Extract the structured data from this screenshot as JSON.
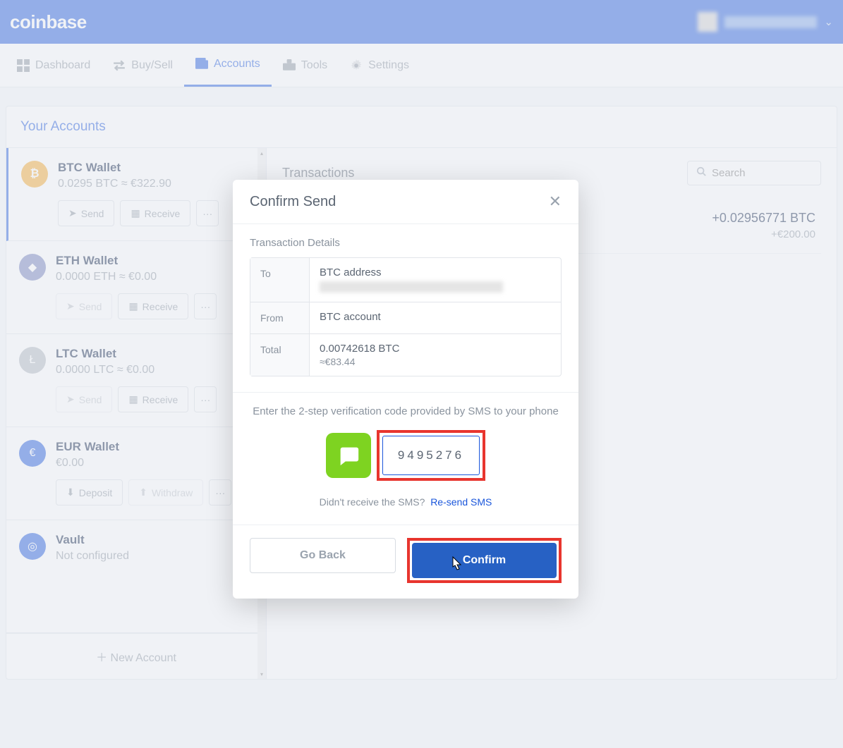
{
  "brand": "coinbase",
  "user": {
    "name": "██████ ██████"
  },
  "nav": [
    {
      "label": "Dashboard",
      "active": false
    },
    {
      "label": "Buy/Sell",
      "active": false
    },
    {
      "label": "Accounts",
      "active": true
    },
    {
      "label": "Tools",
      "active": false
    },
    {
      "label": "Settings",
      "active": false
    }
  ],
  "panel_title": "Your Accounts",
  "wallets": [
    {
      "name": "BTC Wallet",
      "balance": "0.0295 BTC ≈ €322.90",
      "icon": "btc",
      "active": true,
      "send": true,
      "actions": [
        "Send",
        "Receive"
      ]
    },
    {
      "name": "ETH Wallet",
      "balance": "0.0000 ETH ≈ €0.00",
      "icon": "eth",
      "send": false,
      "actions": [
        "Send",
        "Receive"
      ]
    },
    {
      "name": "LTC Wallet",
      "balance": "0.0000 LTC ≈ €0.00",
      "icon": "ltc",
      "send": false,
      "actions": [
        "Send",
        "Receive"
      ]
    },
    {
      "name": "EUR Wallet",
      "balance": "€0.00",
      "icon": "eur",
      "send": true,
      "actions": [
        "Deposit",
        "Withdraw"
      ]
    },
    {
      "name": "Vault",
      "balance": "Not configured",
      "icon": "vault",
      "noactions": true
    }
  ],
  "new_account": "New Account",
  "content": {
    "title": "Transactions",
    "search_placeholder": "Search",
    "tx": {
      "amount": "+0.02956771 BTC",
      "fiat": "+€200.00"
    }
  },
  "modal": {
    "title": "Confirm Send",
    "sub": "Transaction Details",
    "rows": {
      "to_label": "To",
      "to_val": "BTC address",
      "from_label": "From",
      "from_val": "BTC account",
      "total_label": "Total",
      "total_val": "0.00742618 BTC",
      "total_fiat": "≈€83.44"
    },
    "mid_text": "Enter the 2-step verification code provided by SMS to your phone",
    "code": "9495276",
    "resend_q": "Didn't receive the SMS?",
    "resend_link": "Re-send SMS",
    "back": "Go Back",
    "confirm": "Confirm"
  }
}
